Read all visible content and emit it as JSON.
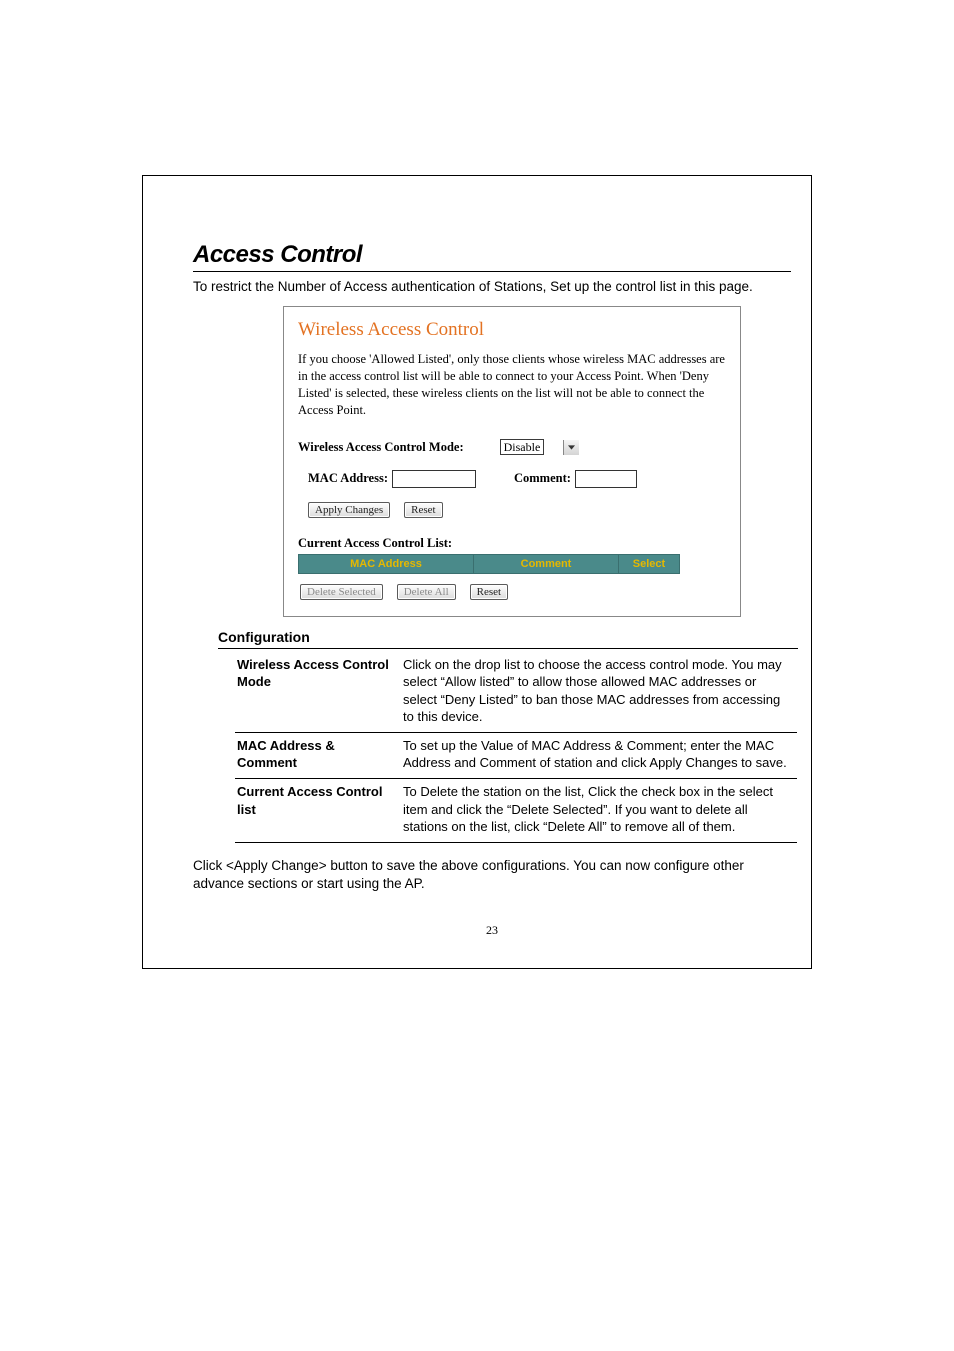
{
  "page": {
    "title": "Access Control",
    "intro": "To restrict the Number of Access authentication of Stations, Set up the control list in this page.",
    "page_number": "23"
  },
  "screenshot": {
    "title": "Wireless Access Control",
    "description": "If you choose 'Allowed Listed', only those clients whose wireless MAC addresses are in the access control list will be able to connect to your Access Point. When 'Deny Listed' is selected, these wireless clients on the list will not be able to connect the Access Point.",
    "mode_label": "Wireless Access Control Mode:",
    "mode_value": "Disable",
    "mac_label": "MAC Address:",
    "comment_label": "Comment:",
    "apply_changes": "Apply Changes",
    "reset": "Reset",
    "list_heading": "Current Access Control List:",
    "col_mac": "MAC Address",
    "col_comment": "Comment",
    "col_select": "Select",
    "delete_selected": "Delete Selected",
    "delete_all": "Delete All",
    "reset2": "Reset"
  },
  "config": {
    "heading": "Configuration",
    "rows": [
      {
        "label": "Wireless Access Control Mode",
        "desc": "Click on the drop list to choose the access control mode. You may select “Allow listed” to allow those allowed MAC addresses or select “Deny Listed” to ban those MAC addresses from accessing to this device."
      },
      {
        "label": "MAC Address & Comment",
        "desc": "To set up the Value of MAC Address & Comment; enter the MAC Address and Comment of station and click Apply Changes to save."
      },
      {
        "label": "Current Access Control list",
        "desc": "To Delete the station on the list, Click the check box in the select item and click the “Delete Selected”. If you want to delete all stations on the list, click “Delete All” to remove all of them."
      }
    ],
    "footer": "Click <Apply Change> button to save the above configurations. You can now configure other advance sections or start using the AP."
  }
}
